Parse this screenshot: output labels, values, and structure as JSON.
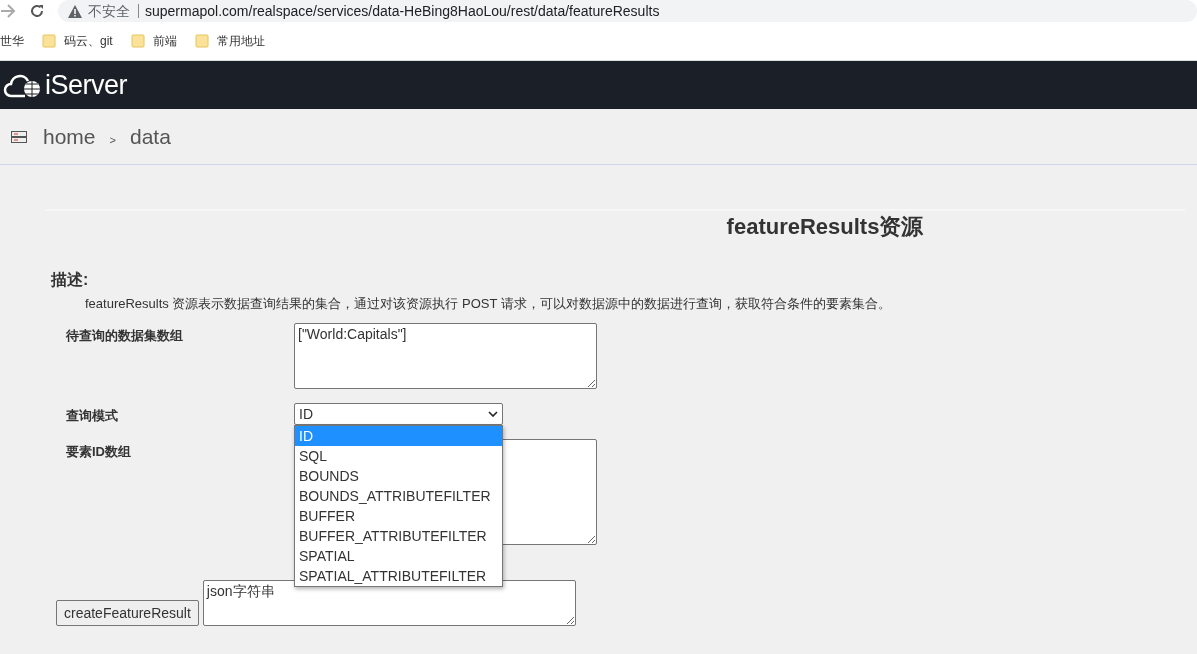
{
  "browser": {
    "security": "不安全",
    "url": "supermapol.com/realspace/services/data-HeBing8HaoLou/rest/data/featureResults",
    "bookmarks": [
      {
        "label": "世华",
        "kind": "plain"
      },
      {
        "label": "码云、git",
        "kind": "folder"
      },
      {
        "label": "前端",
        "kind": "folder"
      },
      {
        "label": "常用地址",
        "kind": "folder"
      }
    ]
  },
  "header": {
    "logo": "iServer"
  },
  "breadcrumb": {
    "items": [
      "home",
      "data"
    ],
    "separator": ">"
  },
  "page": {
    "title": "featureResults资源",
    "description_heading": "描述:",
    "description": "featureResults 资源表示数据查询结果的集合，通过对该资源执行 POST 请求，可以对数据源中的数据进行查询，获取符合条件的要素集合。"
  },
  "form": {
    "datasets": {
      "label": "待查询的数据集数组",
      "value": "[\"World:Capitals\"]"
    },
    "query_mode": {
      "label": "查询模式",
      "value": "ID",
      "expanded": true,
      "options": [
        {
          "label": "ID",
          "selected": true
        },
        {
          "label": "SQL",
          "selected": false
        },
        {
          "label": "BOUNDS",
          "selected": false
        },
        {
          "label": "BOUNDS_ATTRIBUTEFILTER",
          "selected": false
        },
        {
          "label": "BUFFER",
          "selected": false
        },
        {
          "label": "BUFFER_ATTRIBUTEFILTER",
          "selected": false
        },
        {
          "label": "SPATIAL",
          "selected": false
        },
        {
          "label": "SPATIAL_ATTRIBUTEFILTER",
          "selected": false
        }
      ]
    },
    "ids": {
      "label": "要素ID数组"
    },
    "submit": {
      "label": "createFeatureResult",
      "value": "json字符串"
    }
  }
}
